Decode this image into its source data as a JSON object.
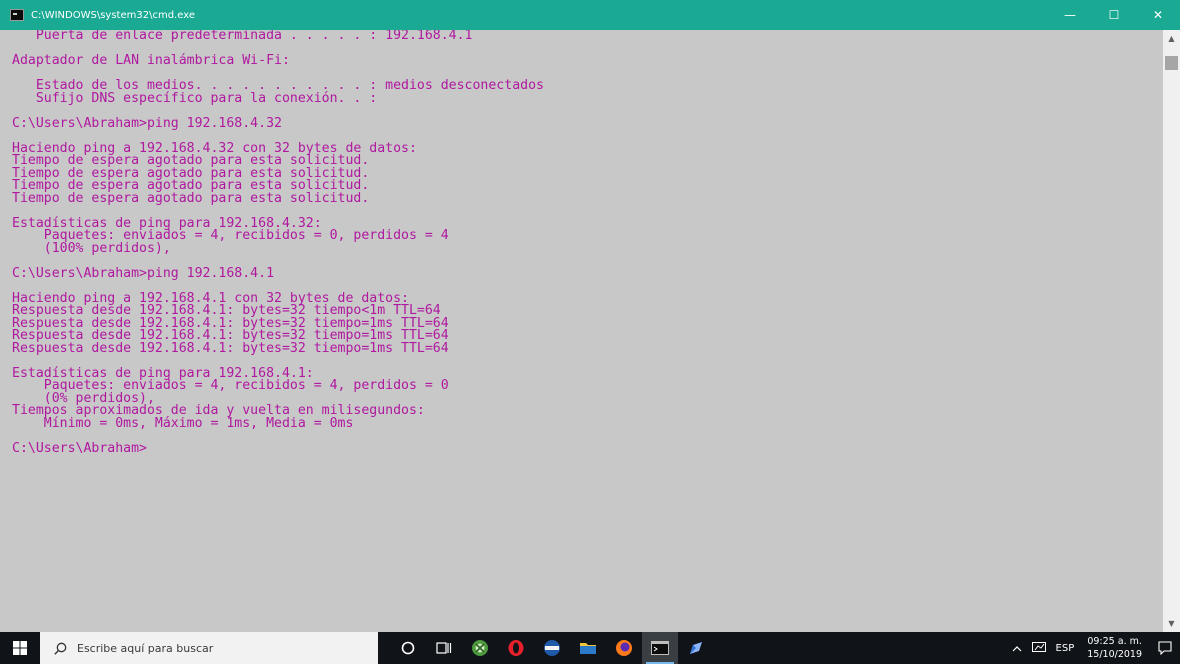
{
  "window": {
    "title": "C:\\WINDOWS\\system32\\cmd.exe",
    "controls": {
      "minimize": "—",
      "maximize": "☐",
      "close": "✕"
    }
  },
  "console": {
    "lines": [
      "   Puerta de enlace predeterminada . . . . . : 192.168.4.1",
      "",
      "Adaptador de LAN inalámbrica Wi-Fi:",
      "",
      "   Estado de los medios. . . . . . . . . . . : medios desconectados",
      "   Sufijo DNS específico para la conexión. . :",
      "",
      "C:\\Users\\Abraham>ping 192.168.4.32",
      "",
      "Haciendo ping a 192.168.4.32 con 32 bytes de datos:",
      "Tiempo de espera agotado para esta solicitud.",
      "Tiempo de espera agotado para esta solicitud.",
      "Tiempo de espera agotado para esta solicitud.",
      "Tiempo de espera agotado para esta solicitud.",
      "",
      "Estadísticas de ping para 192.168.4.32:",
      "    Paquetes: enviados = 4, recibidos = 0, perdidos = 4",
      "    (100% perdidos),",
      "",
      "C:\\Users\\Abraham>ping 192.168.4.1",
      "",
      "Haciendo ping a 192.168.4.1 con 32 bytes de datos:",
      "Respuesta desde 192.168.4.1: bytes=32 tiempo<1m TTL=64",
      "Respuesta desde 192.168.4.1: bytes=32 tiempo=1ms TTL=64",
      "Respuesta desde 192.168.4.1: bytes=32 tiempo=1ms TTL=64",
      "Respuesta desde 192.168.4.1: bytes=32 tiempo=1ms TTL=64",
      "",
      "Estadísticas de ping para 192.168.4.1:",
      "    Paquetes: enviados = 4, recibidos = 4, perdidos = 0",
      "    (0% perdidos),",
      "Tiempos aproximados de ida y vuelta en milisegundos:",
      "    Mínimo = 0ms, Máximo = 1ms, Media = 0ms",
      "",
      "C:\\Users\\Abraham>"
    ]
  },
  "taskbar": {
    "search_placeholder": "Escribe aquí para buscar",
    "apps": [
      {
        "name": "cortana-icon",
        "glyph": "○"
      },
      {
        "name": "task-view-icon",
        "glyph": "⧉"
      },
      {
        "name": "xbox-app-icon",
        "glyph": "●"
      },
      {
        "name": "opera-icon",
        "glyph": "O"
      },
      {
        "name": "app-icon",
        "glyph": "◒"
      },
      {
        "name": "file-explorer-icon",
        "glyph": "▬"
      },
      {
        "name": "firefox-icon",
        "glyph": "◉"
      },
      {
        "name": "cmd-icon",
        "glyph": "▭"
      },
      {
        "name": "pen-icon",
        "glyph": "◢"
      }
    ],
    "tray": {
      "chevron": "^",
      "language": "ESP",
      "time": "09:25 a. m.",
      "date": "15/10/2019"
    }
  },
  "colors": {
    "titlebar": "#1aaa94",
    "console_bg": "#c8c8c8",
    "console_text": "#b0189f",
    "taskbar": "#101418"
  }
}
